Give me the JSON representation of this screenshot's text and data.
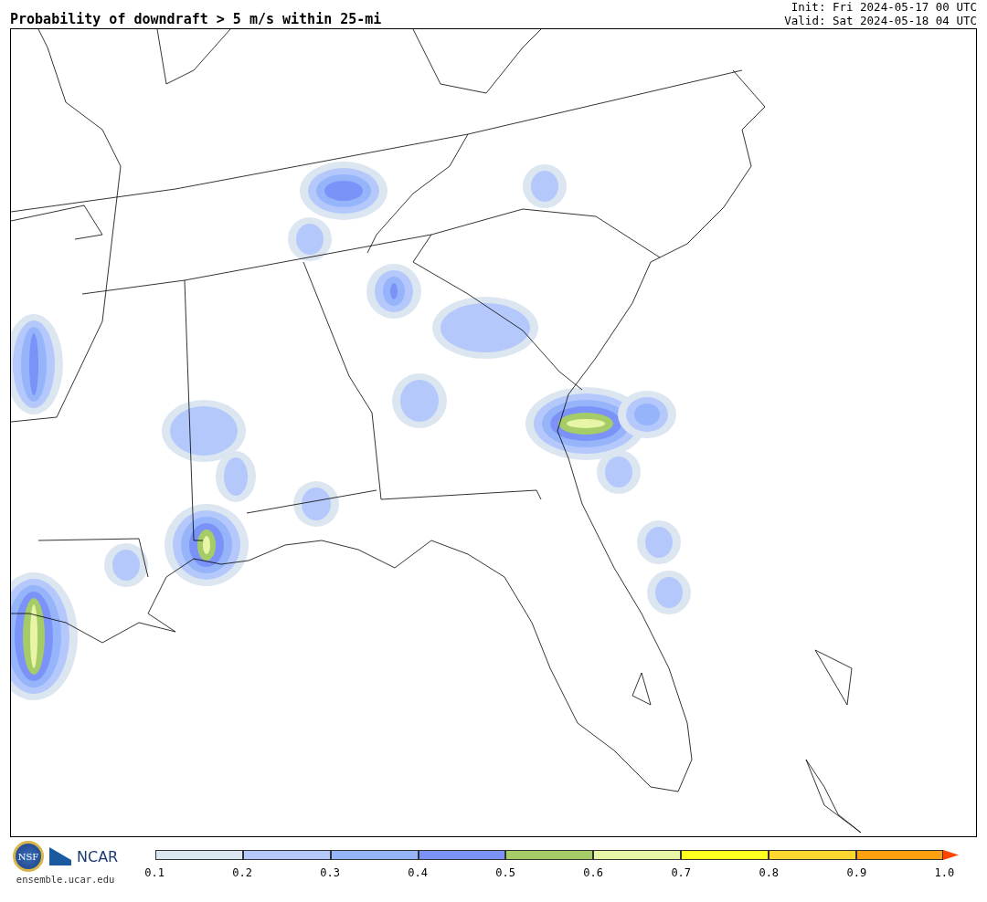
{
  "title": "Probability of downdraft > 5 m/s within 25-mi",
  "init": "Init: Fri 2024-05-17 00 UTC",
  "valid": "Valid: Sat 2024-05-18 04 UTC",
  "logo": {
    "nsf": "NSF",
    "ncar": "NCAR",
    "url": "ensemble.ucar.edu"
  },
  "colorbar": {
    "bins": [
      {
        "color": "#dce6f0"
      },
      {
        "color": "#b4c8fb"
      },
      {
        "color": "#96b4fa"
      },
      {
        "color": "#7b93f8"
      },
      {
        "color": "#a6cc68"
      },
      {
        "color": "#e8f5a6"
      },
      {
        "color": "#ffff20"
      },
      {
        "color": "#ffd530"
      },
      {
        "color": "#ffa010"
      },
      {
        "kind": "extend",
        "color": "#ff4500"
      }
    ],
    "ticks": [
      "0.1",
      "0.2",
      "0.3",
      "0.4",
      "0.5",
      "0.6",
      "0.7",
      "0.8",
      "0.9",
      "1.0"
    ]
  }
}
